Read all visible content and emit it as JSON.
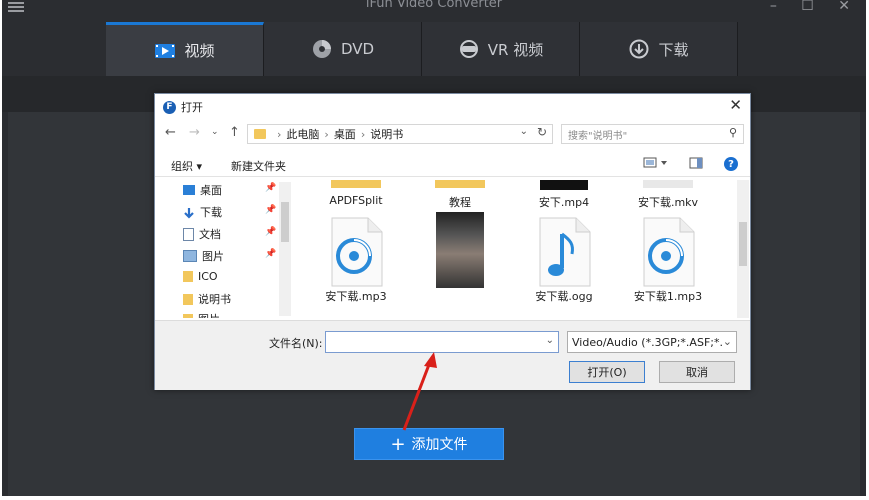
{
  "app": {
    "title": "iFun Video Converter",
    "tabs": [
      {
        "label": "视频",
        "icon": "video-icon",
        "active": true
      },
      {
        "label": "DVD",
        "icon": "dvd-disc-icon",
        "active": false
      },
      {
        "label": "VR 视频",
        "icon": "vr-headset-icon",
        "active": false
      },
      {
        "label": "下载",
        "icon": "download-icon",
        "active": false
      }
    ],
    "add_button": {
      "label": "添加文件",
      "icon": "plus-icon"
    },
    "accent_color": "#1f7fe0"
  },
  "dialog": {
    "title": "打开",
    "breadcrumb": [
      "此电脑",
      "桌面",
      "说明书"
    ],
    "search_placeholder": "搜索\"说明书\"",
    "toolbar": {
      "organize": "组织 ▾",
      "new_folder": "新建文件夹"
    },
    "sidebar": [
      {
        "label": "桌面",
        "icon": "desktop-icon"
      },
      {
        "label": "下载",
        "icon": "download-arrow-icon"
      },
      {
        "label": "文档",
        "icon": "document-icon"
      },
      {
        "label": "图片",
        "icon": "picture-icon"
      },
      {
        "label": "ICO",
        "icon": "folder-icon"
      },
      {
        "label": "说明书",
        "icon": "folder-icon"
      },
      {
        "label": "图片",
        "icon": "folder-icon"
      }
    ],
    "files": [
      {
        "name": "APDFSplit",
        "type": "folder"
      },
      {
        "name": "教程",
        "type": "folder"
      },
      {
        "name": "安下.mp4",
        "type": "video"
      },
      {
        "name": "安下载.mkv",
        "type": "video"
      },
      {
        "name": "安下载.mp3",
        "type": "audio"
      },
      {
        "name": "",
        "type": "video"
      },
      {
        "name": "安下载.ogg",
        "type": "music"
      },
      {
        "name": "安下载1.mp3",
        "type": "audio"
      }
    ],
    "filename_label": "文件名(N):",
    "filename_value": "",
    "filetype_value": "Video/Audio (*.3GP;*.ASF;*.A",
    "open_button": "打开(O)",
    "cancel_button": "取消"
  }
}
